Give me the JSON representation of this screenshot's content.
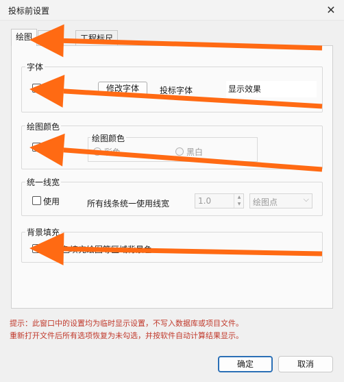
{
  "window": {
    "title": "投标前设置",
    "close_glyph": "✕"
  },
  "tabs": [
    {
      "label": "绘图",
      "active": true
    },
    {
      "label": "…图",
      "active": false
    },
    {
      "label": "工程标尺",
      "active": false
    }
  ],
  "font_group": {
    "title": "字体",
    "checkbox_label": "使用",
    "modify_button": "修改字体",
    "field_label": "投标字体",
    "preview_text": "显示效果"
  },
  "color_group": {
    "title": "绘图颜色",
    "sub_title": "绘图颜色",
    "options": [
      {
        "label": "彩色",
        "checked": true
      },
      {
        "label": "黑白",
        "checked": false
      }
    ]
  },
  "linewidth_group": {
    "title": "统一线宽",
    "checkbox_label": "使用",
    "desc": "所有线条统一使用线宽",
    "value": "1.0",
    "unit": "绘图点"
  },
  "fill_group": {
    "title": "背景填充",
    "checkbox_label": "用底色填充绘图等区域背景色"
  },
  "hints": [
    "提示：此窗口中的设置均为临时显示设置，不写入数据库或项目文件。",
    "重新打开文件后所有选项恢复为未勾选，并按软件自动计算结果显示。"
  ],
  "buttons": {
    "ok": "确定",
    "cancel": "取消"
  },
  "colors": {
    "arrow": "#ff6a13",
    "hint": "#c0392b",
    "accent": "#2a6fb6"
  },
  "icons": {
    "close": "close-icon",
    "spin_up": "chevron-up-icon",
    "spin_down": "chevron-down-icon",
    "combo": "chevron-down-icon"
  }
}
